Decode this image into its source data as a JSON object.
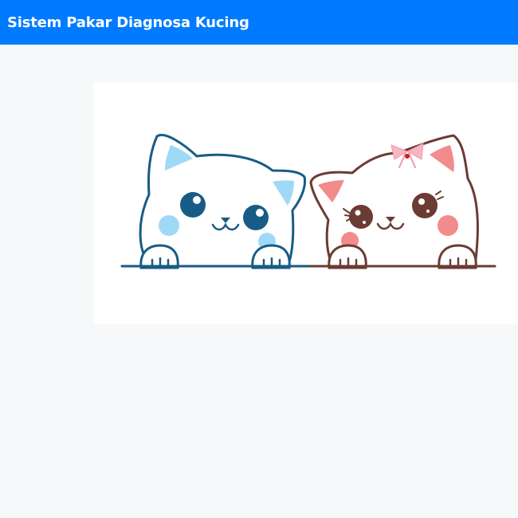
{
  "navbar": {
    "brand": "Sistem Pakar Diagnosa Kucing"
  },
  "hero": {
    "illustration": "two-cute-cats-peeking-illustration",
    "colors": {
      "blue_cat_outline": "#175c85",
      "blue_cat_accent": "#9fd9f6",
      "brown_cat_outline": "#6b3b34",
      "brown_cat_accent": "#f28b8b",
      "bow": "#f7b6c2"
    }
  },
  "colors": {
    "navbar": "#007bff",
    "page_background": "#f7f8fa",
    "card_background": "#ffffff"
  }
}
